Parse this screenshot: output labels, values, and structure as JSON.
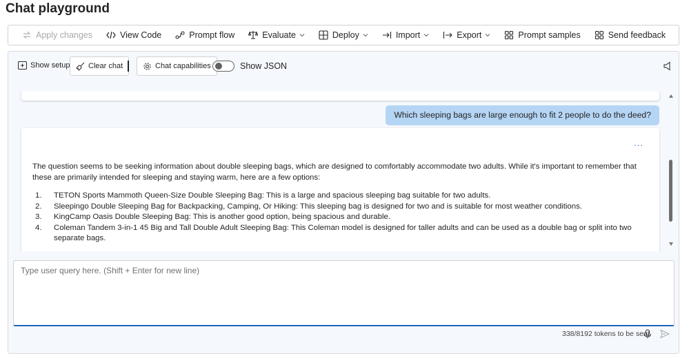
{
  "page": {
    "title": "Chat playground"
  },
  "toolbar": {
    "items": [
      {
        "label": "Apply changes",
        "icon": "apply-changes-icon",
        "disabled": true
      },
      {
        "label": "View Code",
        "icon": "code-icon"
      },
      {
        "label": "Prompt flow",
        "icon": "prompt-flow-icon"
      },
      {
        "label": "Evaluate",
        "icon": "evaluate-icon",
        "dropdown": true
      },
      {
        "label": "Deploy",
        "icon": "deploy-icon",
        "dropdown": true
      },
      {
        "label": "Import",
        "icon": "import-icon",
        "dropdown": true
      },
      {
        "label": "Export",
        "icon": "export-icon",
        "dropdown": true
      },
      {
        "label": "Prompt samples",
        "icon": "grid-icon"
      },
      {
        "label": "Send feedback",
        "icon": "grid-icon"
      }
    ]
  },
  "controls": {
    "show_setup": "Show setup",
    "clear_chat": "Clear chat",
    "chat_capabilities": "Chat capabilities",
    "show_json": "Show JSON",
    "show_json_on": false
  },
  "chat": {
    "user_message": "Which sleeping bags are large enough to fit 2 people to do the deed?",
    "more_label": "...",
    "reply_intro": "The question seems to be seeking information about double sleeping bags, which are designed to comfortably accommodate two adults. While it's important to remember that these are primarily intended for sleeping and staying warm, here are a few options:",
    "reply_items": [
      {
        "num": "1.",
        "text": "TETON Sports Mammoth Queen-Size Double Sleeping Bag: This is a large and spacious sleeping bag suitable for two adults."
      },
      {
        "num": "2.",
        "text": "Sleepingo Double Sleeping Bag for Backpacking, Camping, Or Hiking: This sleeping bag is designed for two and is suitable for most weather conditions."
      },
      {
        "num": "3.",
        "text": "KingCamp Oasis Double Sleeping Bag: This is another good option, being spacious and durable."
      },
      {
        "num": "4.",
        "text": "Coleman Tandem 3-in-1 45 Big and Tall Double Adult Sleeping Bag: This Coleman model is designed for taller adults and can be used as a double bag or split into two separate bags."
      }
    ]
  },
  "input": {
    "placeholder": "Type user query here. (Shift + Enter for new line)",
    "value": "",
    "tokens_text": "338/8192 tokens to be sent"
  },
  "colors": {
    "accent": "#1f63b9",
    "user_bubble": "#b5d5f5",
    "panel_bg": "#f5f8fc"
  }
}
